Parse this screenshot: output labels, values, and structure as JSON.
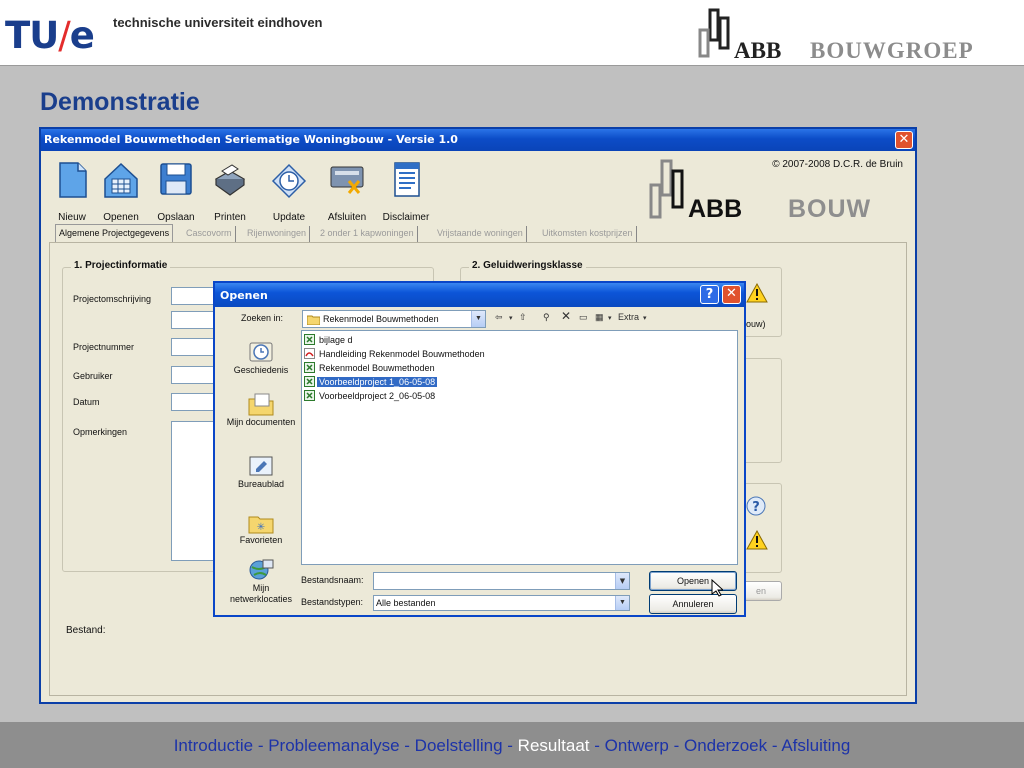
{
  "header": {
    "tue_logo_left": "TU",
    "tue_logo_slash": "/",
    "tue_logo_right": "e",
    "university_name": "technische universiteit eindhoven",
    "abb_text": "ABB",
    "bouwgroep_text": "BOUWGROEP"
  },
  "slide_title": "Demonstratie",
  "app": {
    "title": "Rekenmodel Bouwmethoden Seriematige Woningbouw  -  Versie 1.0",
    "close_glyph": "✕",
    "copyright": "© 2007-2008 D.C.R. de Bruin",
    "logo_abb": "ABB",
    "logo_bouw": "BOUW",
    "toolbar": [
      {
        "label": "Nieuw",
        "icon": "new-document-icon"
      },
      {
        "label": "Openen",
        "icon": "open-house-icon"
      },
      {
        "label": "Opslaan",
        "icon": "floppy-disk-icon"
      },
      {
        "label": "Printen",
        "icon": "printer-icon"
      },
      {
        "label": "Update",
        "icon": "update-clock-icon"
      },
      {
        "label": "Afsluiten",
        "icon": "exit-card-icon"
      },
      {
        "label": "Disclaimer",
        "icon": "disclaimer-document-icon"
      }
    ],
    "tabs": [
      {
        "label": "Algemene Projectgegevens",
        "active": true
      },
      {
        "label": "Cascovorm",
        "active": false
      },
      {
        "label": "Rijenwoningen",
        "active": false
      },
      {
        "label": "2 onder 1 kapwoningen",
        "active": false
      },
      {
        "label": "Vrijstaande woningen",
        "active": false
      },
      {
        "label": "Uitkomsten kostprijzen",
        "active": false
      }
    ],
    "project_group": {
      "title": "1. Projectinformatie",
      "fields": {
        "description": "Projectomschrijving",
        "number": "Projectnummer",
        "user": "Gebruiker",
        "date": "Datum",
        "remarks": "Opmerkingen"
      }
    },
    "sound_group": {
      "title": "2. Geluidweringsklasse",
      "partial_text": "ouw)"
    },
    "partial_button": "en",
    "bestand_label": "Bestand:",
    "colors": {
      "titlebar": "#0c4cc7",
      "window_bg": "#ece9d8",
      "accent": "#1a3e8c"
    }
  },
  "dialog": {
    "title": "Openen",
    "help_glyph": "?",
    "close_glyph": "✕",
    "look_in_label": "Zoeken in:",
    "look_in_value": "Rekenmodel Bouwmethoden",
    "extra_label": "Extra",
    "places": [
      {
        "label": "Geschiedenis",
        "icon": "history-icon"
      },
      {
        "label": "Mijn documenten",
        "icon": "my-documents-icon"
      },
      {
        "label": "Bureaublad",
        "icon": "desktop-icon"
      },
      {
        "label": "Favorieten",
        "icon": "favorites-icon"
      },
      {
        "label": "Mijn netwerklocaties",
        "icon": "network-places-icon"
      }
    ],
    "files": [
      {
        "name": "bijlage d",
        "icon": "excel-file-icon",
        "selected": false
      },
      {
        "name": "Handleiding Rekenmodel Bouwmethoden",
        "icon": "pdf-file-icon",
        "selected": false
      },
      {
        "name": "Rekenmodel Bouwmethoden",
        "icon": "excel-file-icon",
        "selected": false
      },
      {
        "name": "Voorbeeldproject 1_06-05-08",
        "icon": "excel-file-icon",
        "selected": true
      },
      {
        "name": "Voorbeeldproject 2_06-05-08",
        "icon": "excel-file-icon",
        "selected": false
      }
    ],
    "filename_label": "Bestandsnaam:",
    "filename_value": "",
    "filetype_label": "Bestandstypen:",
    "filetype_value": "Alle bestanden",
    "open_button": "Openen",
    "cancel_button": "Annuleren"
  },
  "footer": {
    "items": [
      "Introductie",
      "Probleemanalyse",
      "Doelstelling",
      "Resultaat",
      "Ontwerp",
      "Onderzoek",
      "Afsluiting"
    ],
    "separator": " - ",
    "current_index": 3
  }
}
